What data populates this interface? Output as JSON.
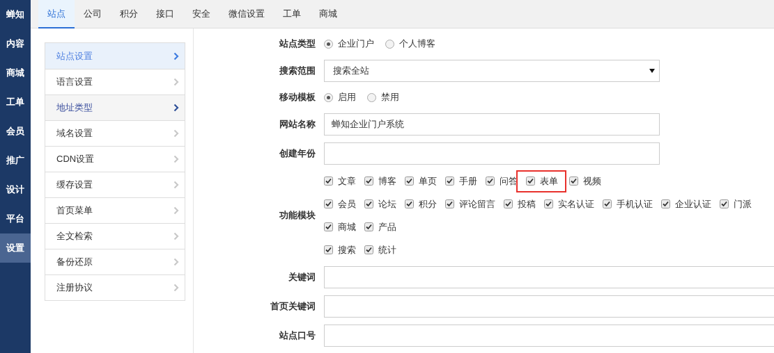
{
  "nav": [
    {
      "label": "蝉知",
      "selected": false
    },
    {
      "label": "内容",
      "selected": false
    },
    {
      "label": "商城",
      "selected": false
    },
    {
      "label": "工单",
      "selected": false
    },
    {
      "label": "会员",
      "selected": false
    },
    {
      "label": "推广",
      "selected": false
    },
    {
      "label": "设计",
      "selected": false
    },
    {
      "label": "平台",
      "selected": false
    },
    {
      "label": "设置",
      "selected": true
    }
  ],
  "tabs": [
    {
      "label": "站点",
      "selected": true
    },
    {
      "label": "公司",
      "selected": false
    },
    {
      "label": "积分",
      "selected": false
    },
    {
      "label": "接口",
      "selected": false
    },
    {
      "label": "安全",
      "selected": false
    },
    {
      "label": "微信设置",
      "selected": false
    },
    {
      "label": "工单",
      "selected": false
    },
    {
      "label": "商城",
      "selected": false
    }
  ],
  "sidebar": {
    "items": [
      {
        "label": "站点设置",
        "selected": true,
        "hovered": false
      },
      {
        "label": "语言设置",
        "selected": false,
        "hovered": false
      },
      {
        "label": "地址类型",
        "selected": false,
        "hovered": true
      },
      {
        "label": "域名设置",
        "selected": false,
        "hovered": false
      },
      {
        "label": "CDN设置",
        "selected": false,
        "hovered": false
      },
      {
        "label": "缓存设置",
        "selected": false,
        "hovered": false
      },
      {
        "label": "首页菜单",
        "selected": false,
        "hovered": false
      },
      {
        "label": "全文检索",
        "selected": false,
        "hovered": false
      },
      {
        "label": "备份还原",
        "selected": false,
        "hovered": false
      },
      {
        "label": "注册协议",
        "selected": false,
        "hovered": false
      }
    ]
  },
  "form": [
    {
      "kind": "radio",
      "label": "站点类型",
      "options": [
        {
          "label": "企业门户",
          "selected": true
        },
        {
          "label": "个人博客",
          "selected": false
        }
      ]
    },
    {
      "kind": "select",
      "label": "搜索范围",
      "value": "搜索全站"
    },
    {
      "kind": "radio",
      "label": "移动模板",
      "options": [
        {
          "label": "启用",
          "selected": true
        },
        {
          "label": "禁用",
          "selected": false
        }
      ]
    },
    {
      "kind": "text",
      "label": "网站名称",
      "value": "蝉知企业门户系统",
      "wide": false
    },
    {
      "kind": "text",
      "label": "创建年份",
      "wide": false
    },
    {
      "kind": "checkboxes",
      "label": "功能模块",
      "groups": [
        {
          "items": [
            {
              "label": "文章",
              "checked": true,
              "highlighted": false
            },
            {
              "label": "博客",
              "checked": true,
              "highlighted": false
            },
            {
              "label": "单页",
              "checked": true,
              "highlighted": false
            },
            {
              "label": "手册",
              "checked": true,
              "highlighted": false
            },
            {
              "label": "问答",
              "checked": true,
              "highlighted": false
            },
            {
              "label": "表单",
              "checked": true,
              "highlighted": true
            },
            {
              "label": "视频",
              "checked": true,
              "highlighted": false
            }
          ]
        },
        {
          "items": [
            {
              "label": "会员",
              "checked": true,
              "highlighted": false
            },
            {
              "label": "论坛",
              "checked": true,
              "highlighted": false
            },
            {
              "label": "积分",
              "checked": true,
              "highlighted": false
            },
            {
              "label": "评论留言",
              "checked": true,
              "highlighted": false
            },
            {
              "label": "投稿",
              "checked": true,
              "highlighted": false
            },
            {
              "label": "实名认证",
              "checked": true,
              "highlighted": false
            },
            {
              "label": "手机认证",
              "checked": true,
              "highlighted": false
            },
            {
              "label": "企业认证",
              "checked": true,
              "highlighted": false
            },
            {
              "label": "门派",
              "checked": true,
              "highlighted": false
            }
          ]
        },
        {
          "items": [
            {
              "label": "商城",
              "checked": true,
              "highlighted": false
            },
            {
              "label": "产品",
              "checked": true,
              "highlighted": false
            }
          ]
        },
        {
          "items": [
            {
              "label": "搜索",
              "checked": true,
              "highlighted": false
            },
            {
              "label": "统计",
              "checked": true,
              "highlighted": false
            }
          ]
        }
      ]
    },
    {
      "kind": "text",
      "label": "关键词",
      "wide": true
    },
    {
      "kind": "text",
      "label": "首页关键词",
      "wide": true
    },
    {
      "kind": "text",
      "label": "站点口号",
      "wide": true
    }
  ]
}
